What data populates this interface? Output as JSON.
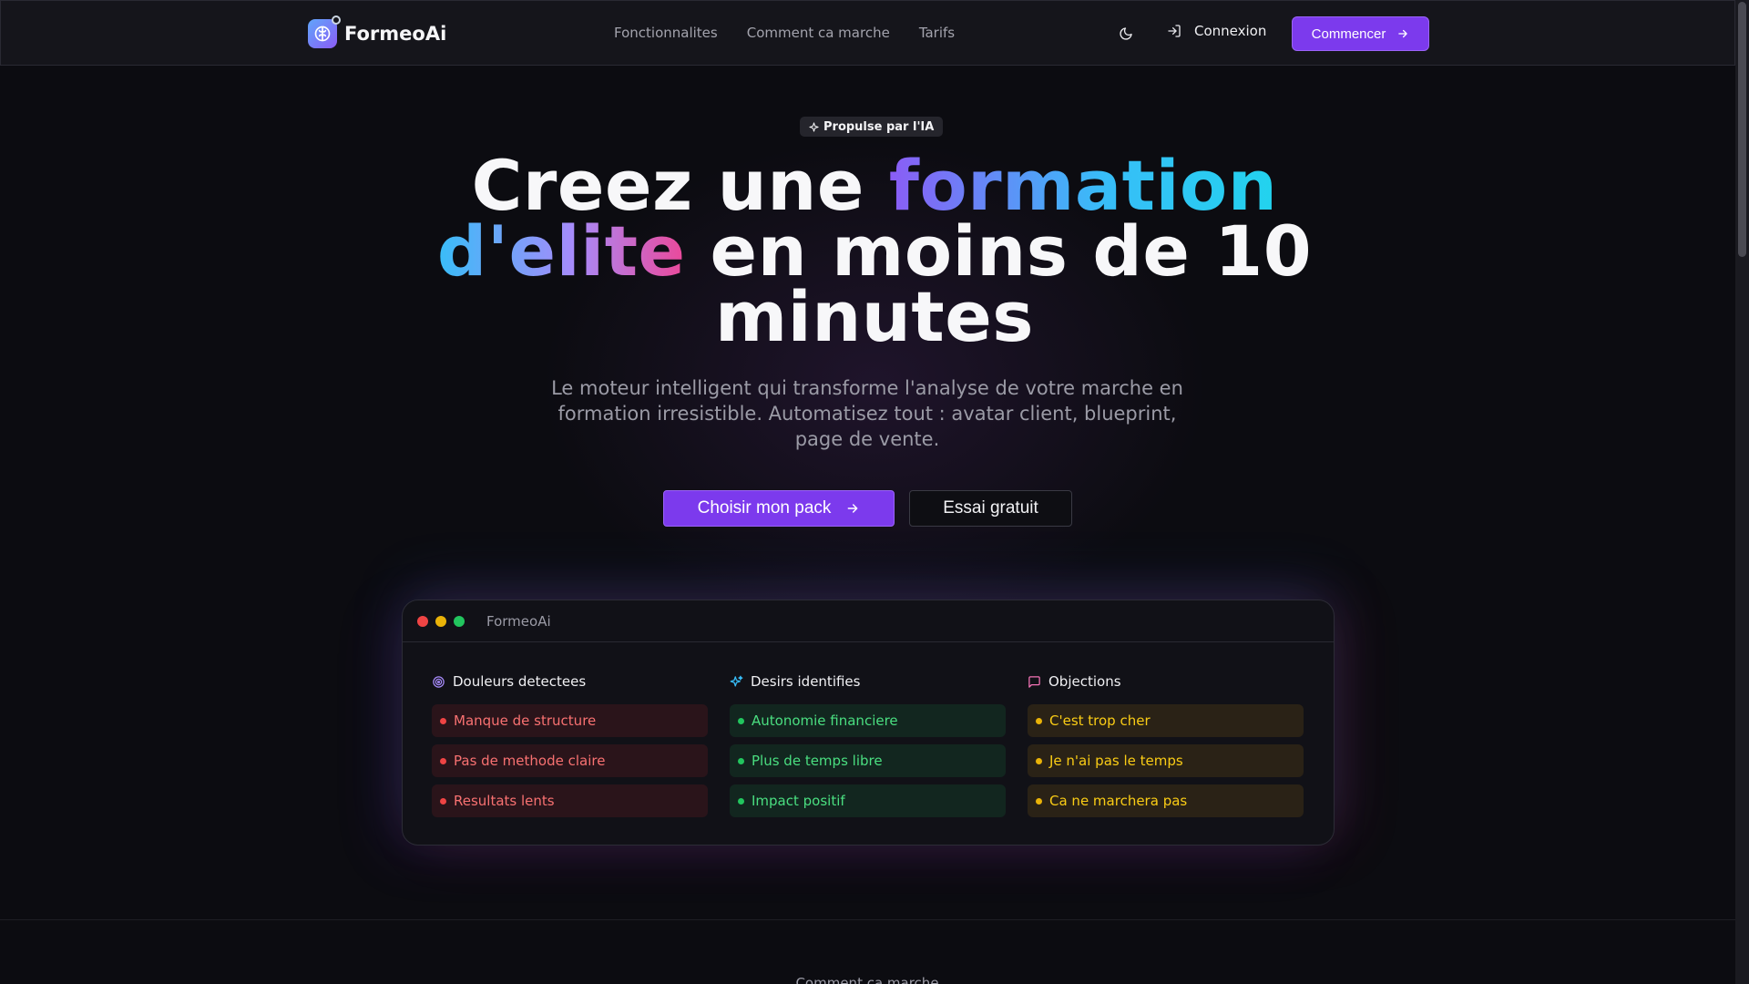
{
  "nav": {
    "logo_text": "FormeoAi",
    "links": [
      "Fonctionnalites",
      "Comment ca marche",
      "Tarifs"
    ],
    "login_label": "Connexion",
    "cta_label": "Commencer"
  },
  "hero": {
    "badge": "Propulse par l'IA",
    "title_part1": "Creez une ",
    "title_highlight1": "formation",
    "title_highlight2": "d'elite",
    "title_part2": " en moins de 10 minutes",
    "subtitle": "Le moteur intelligent qui transforme l'analyse de votre marche en formation irresistible. Automatisez tout : avatar client, blueprint, page de vente.",
    "primary_button": "Choisir mon pack",
    "secondary_button": "Essai gratuit"
  },
  "preview": {
    "window_title": "FormeoAi",
    "columns": [
      {
        "title": "Douleurs detectees",
        "icon": "target-icon",
        "tone": "red",
        "items": [
          "Manque de structure",
          "Pas de methode claire",
          "Resultats lents"
        ]
      },
      {
        "title": "Desirs identifies",
        "icon": "sparkles-icon",
        "tone": "green",
        "items": [
          "Autonomie financiere",
          "Plus de temps libre",
          "Impact positif"
        ]
      },
      {
        "title": "Objections",
        "icon": "message-icon",
        "tone": "yellow",
        "items": [
          "C'est trop cher",
          "Je n'ai pas le temps",
          "Ca ne marchera pas"
        ]
      }
    ]
  },
  "colors": {
    "accent": "#7c3aed",
    "background": "#0c0c11",
    "red": "#f87171",
    "green": "#4ade80",
    "yellow": "#facc15"
  },
  "footer_peek": "Comment ca marche"
}
